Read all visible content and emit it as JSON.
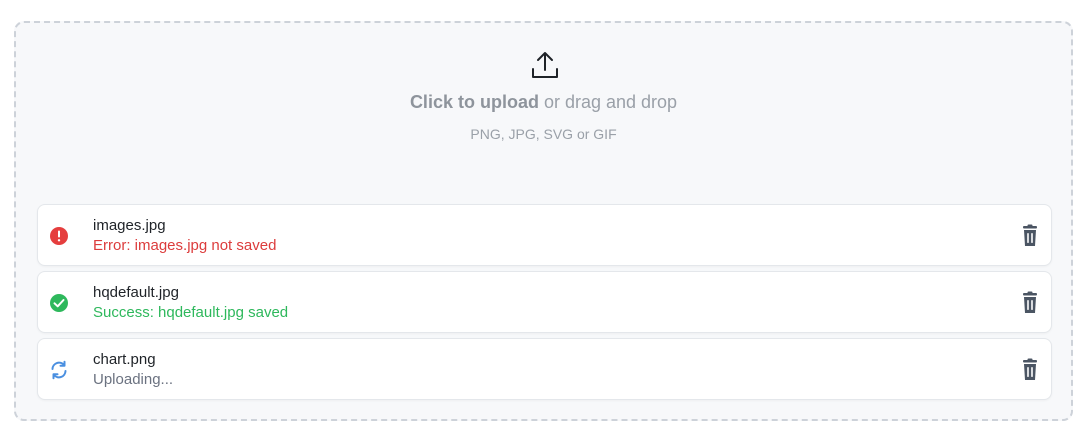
{
  "upload": {
    "action_text": "Click to upload",
    "or_text": " or drag and drop",
    "hint": "PNG, JPG, SVG or GIF"
  },
  "files": [
    {
      "name": "images.jpg",
      "status_text": "Error: images.jpg not saved",
      "state": "error",
      "status_color": "#dc3c3c",
      "icon": "error-icon"
    },
    {
      "name": "hqdefault.jpg",
      "status_text": "Success: hqdefault.jpg saved",
      "state": "success",
      "status_color": "#2eb85c",
      "icon": "check-circle-icon"
    },
    {
      "name": "chart.png",
      "status_text": "Uploading...",
      "state": "uploading",
      "status_color": "#6b7280",
      "icon": "refresh-icon"
    }
  ],
  "delete_icon": "trash-icon"
}
